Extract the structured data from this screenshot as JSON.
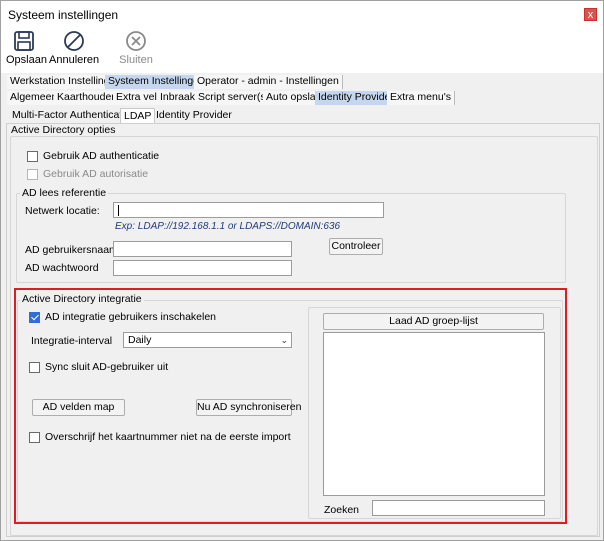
{
  "window": {
    "title": "Systeem instellingen",
    "close_glyph": "x"
  },
  "toolbar": {
    "save": {
      "label": "Opslaan",
      "icon": "floppy-disk-icon"
    },
    "cancel": {
      "label": "Annuleren",
      "icon": "cancel-circle-icon"
    },
    "close": {
      "label": "Sluiten",
      "icon": "close-circle-icon"
    }
  },
  "tabs_level1": [
    "Werkstation Instellingen",
    "Systeem Instellingen",
    "Operator - admin - Instellingen"
  ],
  "tabs_level2": [
    "Algemeen",
    "Kaarthouders",
    "Extra veld",
    "Inbraak",
    "Script server(s)",
    "Auto opslag",
    "Identity Provider",
    "Extra menu's"
  ],
  "tabs_level3": [
    "Multi-Factor Authentication",
    "LDAP",
    "Identity Provider"
  ],
  "ad_options": {
    "group_title": "Active Directory opties",
    "use_auth": {
      "label": "Gebruik AD authenticatie",
      "checked": false
    },
    "use_authz": {
      "label": "Gebruik AD autorisatie",
      "checked": false,
      "disabled": true
    }
  },
  "ad_read": {
    "group_title": "AD lees referentie",
    "network_label": "Netwerk locatie:",
    "network_value": "",
    "network_hint": "Exp: LDAP://192.168.1.1 or LDAPS://DOMAIN:636",
    "user_label": "AD gebruikersnaam",
    "user_value": "",
    "password_label": "AD wachtwoord",
    "password_value": "",
    "check_button": "Controleer"
  },
  "ad_integration": {
    "group_title": "Active Directory integratie",
    "enable": {
      "label": "AD integratie gebruikers inschakelen",
      "checked": true
    },
    "interval_label": "Integratie-interval",
    "interval_value": "Daily",
    "sync_close": {
      "label": "Sync sluit AD-gebruiker uit",
      "checked": false
    },
    "fields_map_button": "AD velden map",
    "sync_now_button": "Nu AD synchroniseren",
    "no_overwrite": {
      "label": "Overschrijf het kaartnummer niet na de eerste import",
      "checked": false
    },
    "load_groups_button": "Laad AD groep-lijst",
    "search_label": "Zoeken",
    "search_value": ""
  },
  "colors": {
    "highlight": "#e01b24",
    "checkbox_checked": "#2f6fd1",
    "selected_tab": "#c5d7ef"
  }
}
